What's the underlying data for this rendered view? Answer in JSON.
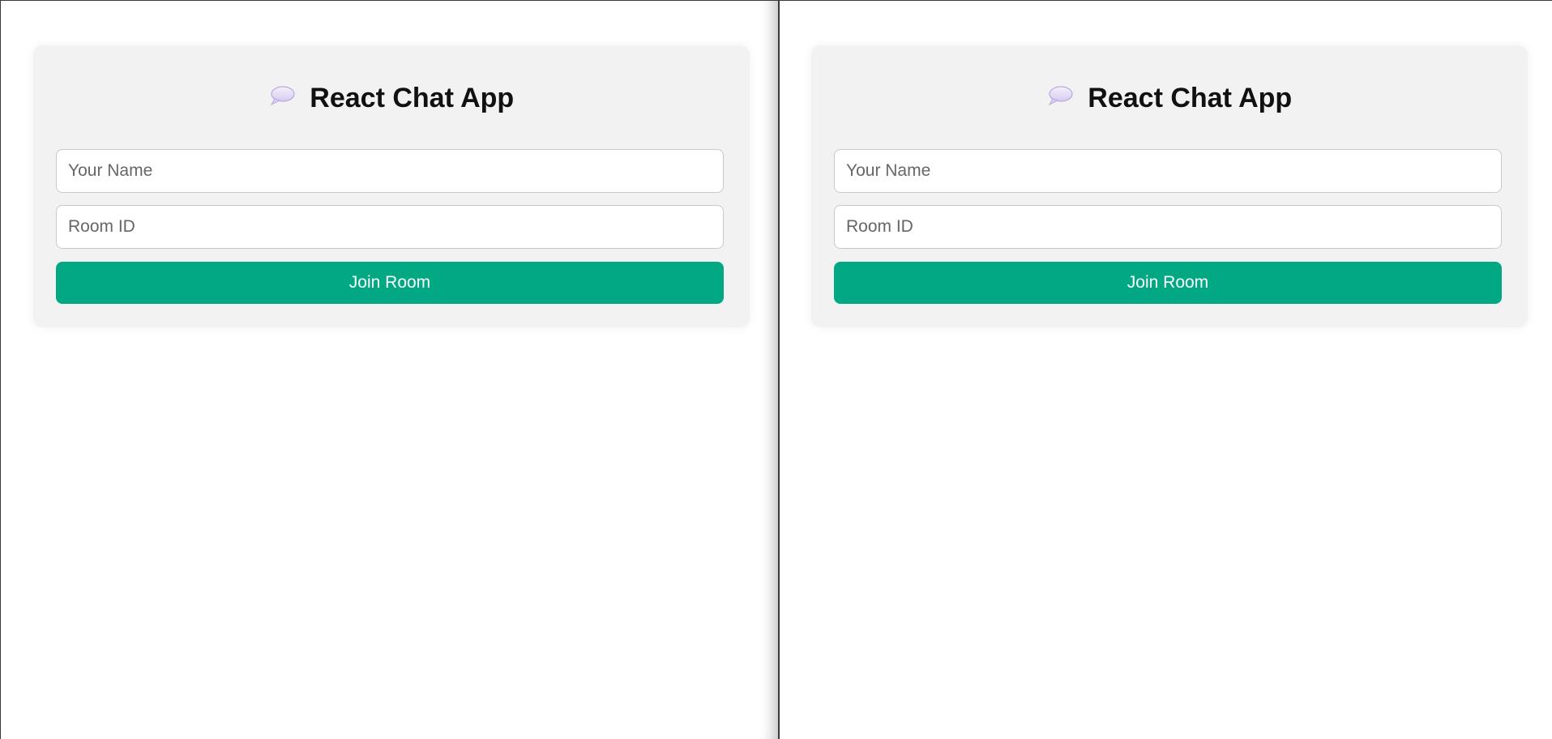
{
  "panes": [
    {
      "title": "React Chat App",
      "icon": "speech-bubble-icon",
      "name_placeholder": "Your Name",
      "room_placeholder": "Room ID",
      "join_label": "Join Room"
    },
    {
      "title": "React Chat App",
      "icon": "speech-bubble-icon",
      "name_placeholder": "Your Name",
      "room_placeholder": "Room ID",
      "join_label": "Join Room"
    }
  ],
  "colors": {
    "card_bg": "#f2f2f2",
    "button_bg": "#02a884",
    "button_text": "#ffffff",
    "title_text": "#111111",
    "icon_fill": "#e6def5"
  }
}
